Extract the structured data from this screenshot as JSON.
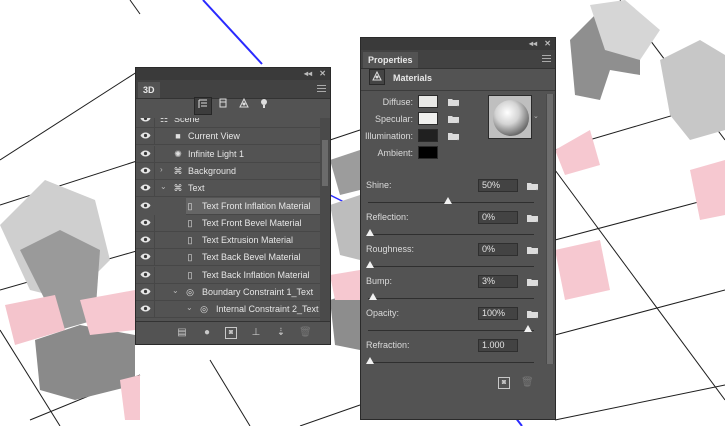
{
  "panel_3d": {
    "tab_label": "3D",
    "collapse_glyph": "◂◂",
    "close_glyph": "✕",
    "filter_buttons": [
      "whole-scene-icon",
      "meshes-icon",
      "materials-icon",
      "lights-icon"
    ],
    "scene_items": [
      {
        "label": "Scene",
        "icon": "scene-icon",
        "visible": true,
        "level": 0
      },
      {
        "label": "Current View",
        "icon": "camera-icon",
        "visible": true,
        "level": 1
      },
      {
        "label": "Infinite Light 1",
        "icon": "light-icon",
        "visible": true,
        "level": 1
      },
      {
        "label": "Background",
        "icon": "mesh-icon",
        "visible": true,
        "level": 1,
        "expanded": false
      },
      {
        "label": "Text",
        "icon": "mesh-icon",
        "visible": true,
        "level": 1,
        "expanded": true
      },
      {
        "label": "Text Front Inflation Material",
        "icon": "material-icon",
        "visible": true,
        "level": 2,
        "selected": true
      },
      {
        "label": "Text Front Bevel Material",
        "icon": "material-icon",
        "visible": true,
        "level": 2
      },
      {
        "label": "Text Extrusion Material",
        "icon": "material-icon",
        "visible": true,
        "level": 2
      },
      {
        "label": "Text Back Bevel Material",
        "icon": "material-icon",
        "visible": true,
        "level": 2
      },
      {
        "label": "Text Back Inflation Material",
        "icon": "material-icon",
        "visible": true,
        "level": 2
      },
      {
        "label": "Boundary Constraint 1_Text",
        "icon": "constraint-icon",
        "visible": true,
        "level": 2
      },
      {
        "label": "Internal Constraint 2_Text",
        "icon": "constraint-icon",
        "visible": true,
        "level": 3
      }
    ],
    "bottom_buttons": [
      "new-mesh-icon",
      "add-light-icon",
      "render-icon",
      "ground-plane-icon",
      "align-icon",
      "trash-icon"
    ]
  },
  "properties": {
    "tab_label": "Properties",
    "collapse_glyph": "◂◂",
    "close_glyph": "✕",
    "section_label": "Materials",
    "colors": [
      {
        "label": "Diffuse:",
        "color": "#e8e8e6"
      },
      {
        "label": "Specular:",
        "color": "#f0f0ee"
      },
      {
        "label": "Illumination:",
        "color": "#202020"
      },
      {
        "label": "Ambient:",
        "color": "#000000"
      }
    ],
    "params": [
      {
        "label": "Shine:",
        "value": "50%",
        "fraction": 0.5,
        "has_folder": true
      },
      {
        "label": "Reflection:",
        "value": "0%",
        "fraction": 0.0,
        "has_folder": true
      },
      {
        "label": "Roughness:",
        "value": "0%",
        "fraction": 0.0,
        "has_folder": true
      },
      {
        "label": "Bump:",
        "value": "3%",
        "fraction": 0.03,
        "has_folder": true
      },
      {
        "label": "Opacity:",
        "value": "100%",
        "fraction": 1.0,
        "has_folder": true
      },
      {
        "label": "Refraction:",
        "value": "1.000",
        "fraction": 0.0,
        "has_folder": false
      }
    ]
  },
  "accent_colors": {
    "guide_line": "#2a2aff",
    "text_shadow_pink": "#f4c4cc"
  }
}
